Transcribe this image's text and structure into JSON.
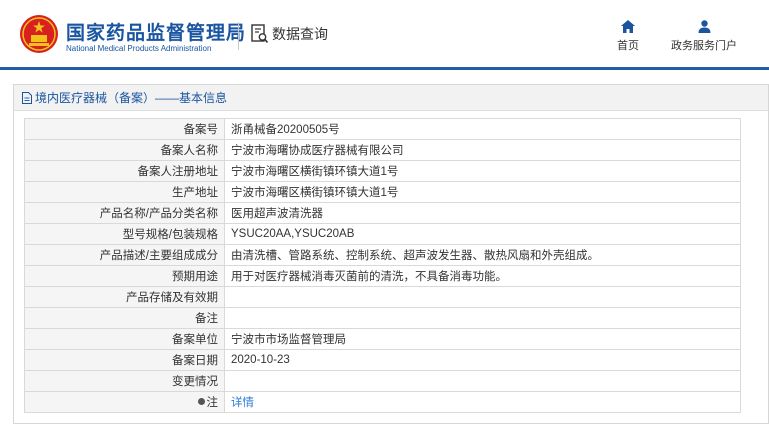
{
  "header": {
    "brand_cn": "国家药品监督管理局",
    "brand_en": "National Medical Products Administration",
    "query_label": "数据查询",
    "nav": {
      "home": "首页",
      "portal": "政务服务门户"
    }
  },
  "colors": {
    "brand_blue": "#1a55a0",
    "link_blue": "#2b7bd6",
    "logo_red": "#d7201f",
    "logo_gold": "#f2c21b"
  },
  "panel": {
    "title": "境内医疗器械（备案）——基本信息"
  },
  "rows": [
    {
      "key": "备案号",
      "value": "浙甬械备20200505号"
    },
    {
      "key": "备案人名称",
      "value": "宁波市海曙协成医疗器械有限公司"
    },
    {
      "key": "备案人注册地址",
      "value": "宁波市海曙区横街镇环镇大道1号"
    },
    {
      "key": "生产地址",
      "value": "宁波市海曙区横街镇环镇大道1号"
    },
    {
      "key": "产品名称/产品分类名称",
      "value": "医用超声波清洗器"
    },
    {
      "key": "型号规格/包装规格",
      "value": "YSUC20AA,YSUC20AB"
    },
    {
      "key": "产品描述/主要组成成分",
      "value": "由清洗槽、管路系统、控制系统、超声波发生器、散热风扇和外壳组成。"
    },
    {
      "key": "预期用途",
      "value": "用于对医疗器械消毒灭菌前的清洗，不具备消毒功能。"
    },
    {
      "key": "产品存储及有效期",
      "value": ""
    },
    {
      "key": "备注",
      "value": ""
    },
    {
      "key": "备案单位",
      "value": "宁波市市场监督管理局"
    },
    {
      "key": "备案日期",
      "value": "2020-10-23"
    },
    {
      "key": "变更情况",
      "value": ""
    }
  ],
  "note_row": {
    "key": "注",
    "link": "详情"
  }
}
